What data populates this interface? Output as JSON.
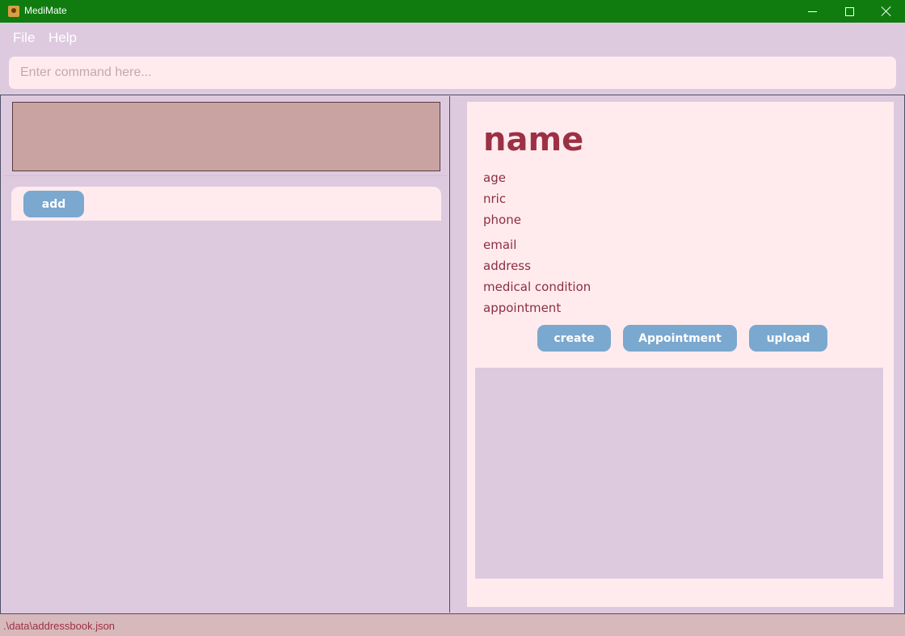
{
  "window": {
    "title": "MediMate",
    "icons": {
      "app": "medimate-app-icon",
      "minimize": "minimize-icon",
      "maximize": "maximize-icon",
      "close": "close-icon"
    }
  },
  "menu": {
    "items": [
      "File",
      "Help"
    ]
  },
  "command": {
    "placeholder": "Enter command here...",
    "value": ""
  },
  "left": {
    "add_label": "add"
  },
  "detail": {
    "name": "name",
    "age": "age",
    "nric": "nric",
    "phone": "phone",
    "email": "email",
    "address": "address",
    "medical_condition": "medical condition",
    "appointment": "appointment",
    "buttons": {
      "create": "create",
      "appointment": "Appointment",
      "upload": "upload"
    }
  },
  "status": {
    "path": ".\\data\\addressbook.json"
  },
  "colors": {
    "titlebar": "#107c10",
    "background": "#decadf",
    "card": "#ffebee",
    "button": "#7aa8cf",
    "accent_text": "#9c3045",
    "result_box": "#c9a3a1",
    "statusbar": "#d8b9bb"
  }
}
